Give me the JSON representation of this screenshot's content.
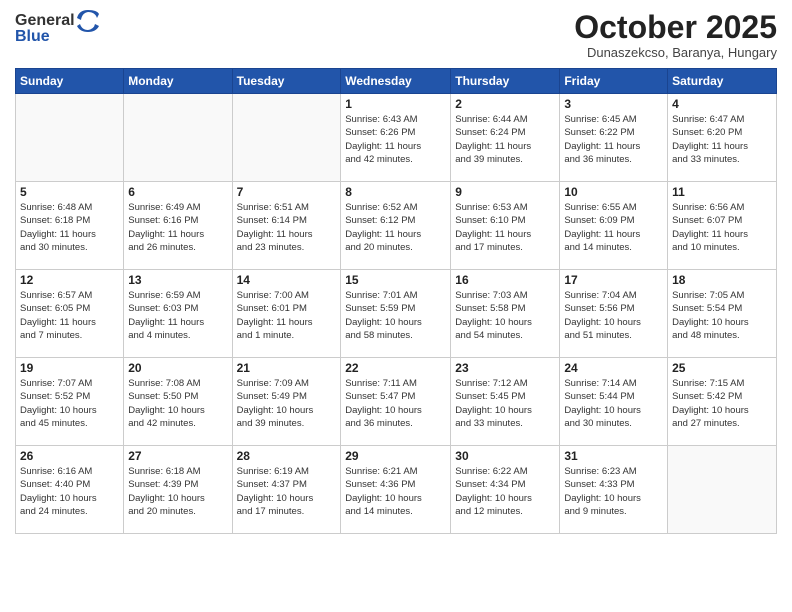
{
  "header": {
    "logo_general": "General",
    "logo_blue": "Blue",
    "month_title": "October 2025",
    "location": "Dunaszekcso, Baranya, Hungary"
  },
  "weekdays": [
    "Sunday",
    "Monday",
    "Tuesday",
    "Wednesday",
    "Thursday",
    "Friday",
    "Saturday"
  ],
  "weeks": [
    [
      {
        "day": "",
        "info": ""
      },
      {
        "day": "",
        "info": ""
      },
      {
        "day": "",
        "info": ""
      },
      {
        "day": "1",
        "info": "Sunrise: 6:43 AM\nSunset: 6:26 PM\nDaylight: 11 hours\nand 42 minutes."
      },
      {
        "day": "2",
        "info": "Sunrise: 6:44 AM\nSunset: 6:24 PM\nDaylight: 11 hours\nand 39 minutes."
      },
      {
        "day": "3",
        "info": "Sunrise: 6:45 AM\nSunset: 6:22 PM\nDaylight: 11 hours\nand 36 minutes."
      },
      {
        "day": "4",
        "info": "Sunrise: 6:47 AM\nSunset: 6:20 PM\nDaylight: 11 hours\nand 33 minutes."
      }
    ],
    [
      {
        "day": "5",
        "info": "Sunrise: 6:48 AM\nSunset: 6:18 PM\nDaylight: 11 hours\nand 30 minutes."
      },
      {
        "day": "6",
        "info": "Sunrise: 6:49 AM\nSunset: 6:16 PM\nDaylight: 11 hours\nand 26 minutes."
      },
      {
        "day": "7",
        "info": "Sunrise: 6:51 AM\nSunset: 6:14 PM\nDaylight: 11 hours\nand 23 minutes."
      },
      {
        "day": "8",
        "info": "Sunrise: 6:52 AM\nSunset: 6:12 PM\nDaylight: 11 hours\nand 20 minutes."
      },
      {
        "day": "9",
        "info": "Sunrise: 6:53 AM\nSunset: 6:10 PM\nDaylight: 11 hours\nand 17 minutes."
      },
      {
        "day": "10",
        "info": "Sunrise: 6:55 AM\nSunset: 6:09 PM\nDaylight: 11 hours\nand 14 minutes."
      },
      {
        "day": "11",
        "info": "Sunrise: 6:56 AM\nSunset: 6:07 PM\nDaylight: 11 hours\nand 10 minutes."
      }
    ],
    [
      {
        "day": "12",
        "info": "Sunrise: 6:57 AM\nSunset: 6:05 PM\nDaylight: 11 hours\nand 7 minutes."
      },
      {
        "day": "13",
        "info": "Sunrise: 6:59 AM\nSunset: 6:03 PM\nDaylight: 11 hours\nand 4 minutes."
      },
      {
        "day": "14",
        "info": "Sunrise: 7:00 AM\nSunset: 6:01 PM\nDaylight: 11 hours\nand 1 minute."
      },
      {
        "day": "15",
        "info": "Sunrise: 7:01 AM\nSunset: 5:59 PM\nDaylight: 10 hours\nand 58 minutes."
      },
      {
        "day": "16",
        "info": "Sunrise: 7:03 AM\nSunset: 5:58 PM\nDaylight: 10 hours\nand 54 minutes."
      },
      {
        "day": "17",
        "info": "Sunrise: 7:04 AM\nSunset: 5:56 PM\nDaylight: 10 hours\nand 51 minutes."
      },
      {
        "day": "18",
        "info": "Sunrise: 7:05 AM\nSunset: 5:54 PM\nDaylight: 10 hours\nand 48 minutes."
      }
    ],
    [
      {
        "day": "19",
        "info": "Sunrise: 7:07 AM\nSunset: 5:52 PM\nDaylight: 10 hours\nand 45 minutes."
      },
      {
        "day": "20",
        "info": "Sunrise: 7:08 AM\nSunset: 5:50 PM\nDaylight: 10 hours\nand 42 minutes."
      },
      {
        "day": "21",
        "info": "Sunrise: 7:09 AM\nSunset: 5:49 PM\nDaylight: 10 hours\nand 39 minutes."
      },
      {
        "day": "22",
        "info": "Sunrise: 7:11 AM\nSunset: 5:47 PM\nDaylight: 10 hours\nand 36 minutes."
      },
      {
        "day": "23",
        "info": "Sunrise: 7:12 AM\nSunset: 5:45 PM\nDaylight: 10 hours\nand 33 minutes."
      },
      {
        "day": "24",
        "info": "Sunrise: 7:14 AM\nSunset: 5:44 PM\nDaylight: 10 hours\nand 30 minutes."
      },
      {
        "day": "25",
        "info": "Sunrise: 7:15 AM\nSunset: 5:42 PM\nDaylight: 10 hours\nand 27 minutes."
      }
    ],
    [
      {
        "day": "26",
        "info": "Sunrise: 6:16 AM\nSunset: 4:40 PM\nDaylight: 10 hours\nand 24 minutes."
      },
      {
        "day": "27",
        "info": "Sunrise: 6:18 AM\nSunset: 4:39 PM\nDaylight: 10 hours\nand 20 minutes."
      },
      {
        "day": "28",
        "info": "Sunrise: 6:19 AM\nSunset: 4:37 PM\nDaylight: 10 hours\nand 17 minutes."
      },
      {
        "day": "29",
        "info": "Sunrise: 6:21 AM\nSunset: 4:36 PM\nDaylight: 10 hours\nand 14 minutes."
      },
      {
        "day": "30",
        "info": "Sunrise: 6:22 AM\nSunset: 4:34 PM\nDaylight: 10 hours\nand 12 minutes."
      },
      {
        "day": "31",
        "info": "Sunrise: 6:23 AM\nSunset: 4:33 PM\nDaylight: 10 hours\nand 9 minutes."
      },
      {
        "day": "",
        "info": ""
      }
    ]
  ]
}
